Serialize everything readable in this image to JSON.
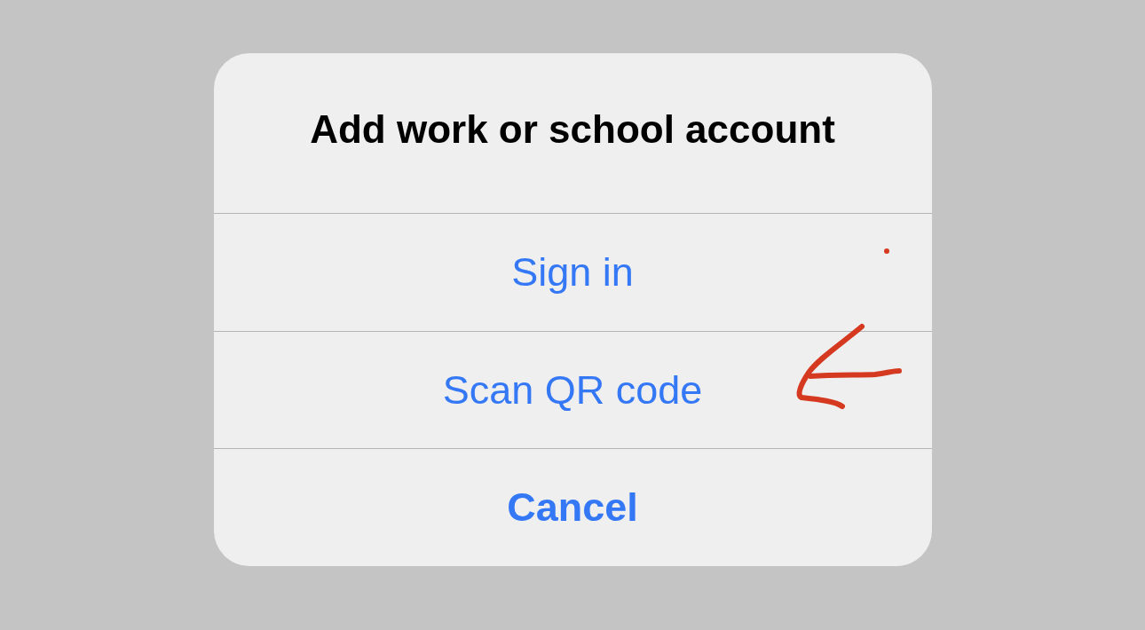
{
  "dialog": {
    "title": "Add work or school account",
    "actions": [
      {
        "label": "Sign in",
        "kind": "default"
      },
      {
        "label": "Scan QR code",
        "kind": "default"
      },
      {
        "label": "Cancel",
        "kind": "cancel"
      }
    ]
  }
}
